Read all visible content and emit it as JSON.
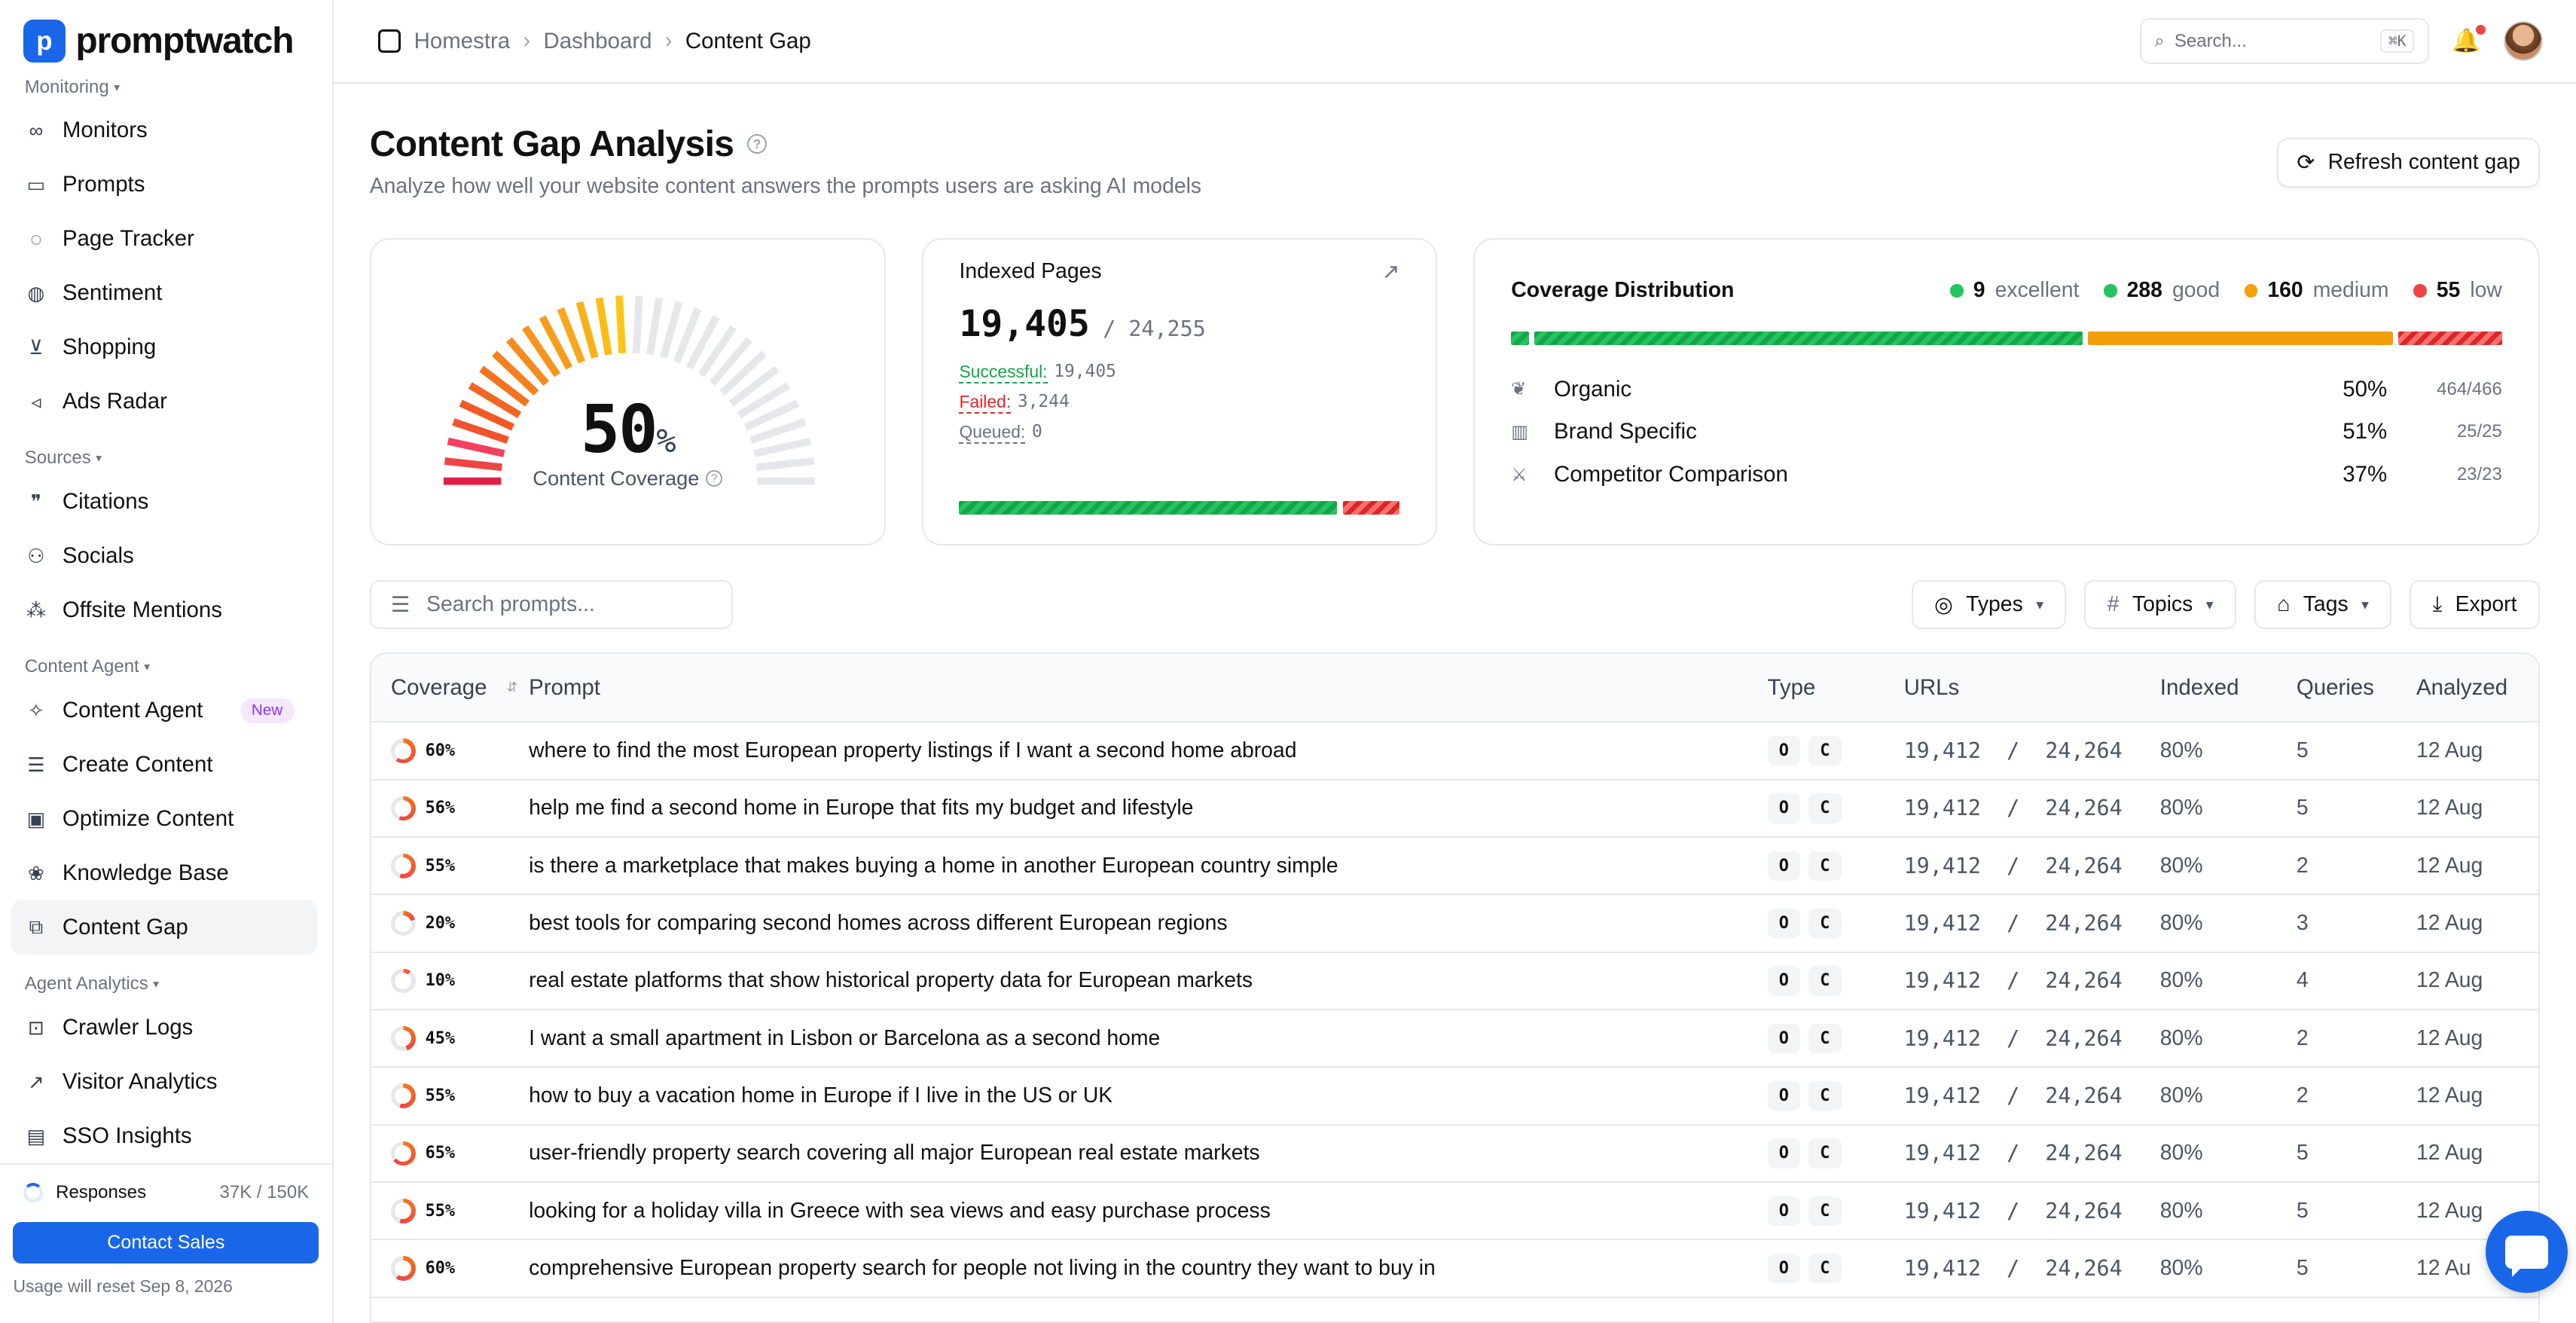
{
  "app": {
    "name": "promptwatch",
    "logo_letter": "p"
  },
  "sidebar": {
    "sections": [
      {
        "label": "Monitoring",
        "items": [
          {
            "label": "Monitors",
            "icon": "binoculars-icon"
          },
          {
            "label": "Prompts",
            "icon": "prompt-icon"
          },
          {
            "label": "Page Tracker",
            "icon": "target-icon"
          },
          {
            "label": "Sentiment",
            "icon": "shield-icon"
          },
          {
            "label": "Shopping",
            "icon": "cart-icon"
          },
          {
            "label": "Ads Radar",
            "icon": "megaphone-icon"
          }
        ]
      },
      {
        "label": "Sources",
        "items": [
          {
            "label": "Citations",
            "icon": "quote-icon"
          },
          {
            "label": "Socials",
            "icon": "users-icon"
          },
          {
            "label": "Offsite Mentions",
            "icon": "share-icon"
          }
        ]
      },
      {
        "label": "Content Agent",
        "items": [
          {
            "label": "Content Agent",
            "icon": "sparkles-icon",
            "badge": "New"
          },
          {
            "label": "Create Content",
            "icon": "document-icon"
          },
          {
            "label": "Optimize Content",
            "icon": "image-icon"
          },
          {
            "label": "Knowledge Base",
            "icon": "brain-icon"
          },
          {
            "label": "Content Gap",
            "icon": "puzzle-icon",
            "active": true
          }
        ]
      },
      {
        "label": "Agent Analytics",
        "items": [
          {
            "label": "Crawler Logs",
            "icon": "robot-icon"
          },
          {
            "label": "Visitor Analytics",
            "icon": "chart-line-icon"
          },
          {
            "label": "SSO Insights",
            "icon": "chart-icon"
          }
        ]
      }
    ],
    "responses_label": "Responses",
    "responses_value": "37K / 150K",
    "contact_label": "Contact Sales",
    "reset_text": "Usage will reset Sep 8, 2026"
  },
  "topbar": {
    "breadcrumb": [
      "Homestra",
      "Dashboard",
      "Content Gap"
    ],
    "search_placeholder": "Search...",
    "search_shortcut": "⌘K"
  },
  "header": {
    "title": "Content Gap Analysis",
    "subtitle": "Analyze how well your website content answers the prompts users are asking AI models",
    "refresh_label": "Refresh content gap"
  },
  "gauge": {
    "value": "50",
    "unit": "%",
    "label": "Content Coverage",
    "fraction": 0.5
  },
  "indexed": {
    "title": "Indexed Pages",
    "indexed": "19,405",
    "total": "/ 24,255",
    "successful_label": "Successful:",
    "successful": "19,405",
    "failed_label": "Failed:",
    "failed": "3,244",
    "queued_label": "Queued:",
    "queued": "0",
    "success_ratio": 0.857
  },
  "coverage": {
    "title": "Coverage Distribution",
    "legend": [
      {
        "count": "9",
        "label": "excellent",
        "color": "#22c55e"
      },
      {
        "count": "288",
        "label": "good",
        "color": "#22c55e"
      },
      {
        "count": "160",
        "label": "medium",
        "color": "#f59e0b"
      },
      {
        "count": "55",
        "label": "low",
        "color": "#ef4444"
      }
    ],
    "rows": [
      {
        "label": "Organic",
        "pct": "50%",
        "frac": "464/466",
        "icon": "sprout-icon"
      },
      {
        "label": "Brand Specific",
        "pct": "51%",
        "frac": "25/25",
        "icon": "building-icon"
      },
      {
        "label": "Competitor Comparison",
        "pct": "37%",
        "frac": "23/23",
        "icon": "swords-icon"
      }
    ]
  },
  "filters": {
    "search_placeholder": "Search prompts...",
    "types": "Types",
    "topics": "Topics",
    "tags": "Tags",
    "export": "Export"
  },
  "table": {
    "headers": {
      "coverage": "Coverage",
      "prompt": "Prompt",
      "type": "Type",
      "urls": "URLs",
      "indexed": "Indexed",
      "queries": "Queries",
      "analyzed": "Analyzed"
    },
    "rows": [
      {
        "coverage": "60%",
        "cov": 60,
        "prompt": "where to find the most European property listings if I want a second home abroad",
        "t1": "O",
        "t2": "C",
        "urls": "19,412  /  24,264",
        "indexed": "80%",
        "queries": "5",
        "analyzed": "12 Aug"
      },
      {
        "coverage": "56%",
        "cov": 56,
        "prompt": "help me find a second home in Europe that fits my budget and lifestyle",
        "t1": "O",
        "t2": "C",
        "urls": "19,412  /  24,264",
        "indexed": "80%",
        "queries": "5",
        "analyzed": "12 Aug"
      },
      {
        "coverage": "55%",
        "cov": 55,
        "prompt": "is there a marketplace that makes buying a home in another European country simple",
        "t1": "O",
        "t2": "C",
        "urls": "19,412  /  24,264",
        "indexed": "80%",
        "queries": "2",
        "analyzed": "12 Aug"
      },
      {
        "coverage": "20%",
        "cov": 20,
        "prompt": "best tools for comparing second homes across different European regions",
        "t1": "O",
        "t2": "C",
        "urls": "19,412  /  24,264",
        "indexed": "80%",
        "queries": "3",
        "analyzed": "12 Aug"
      },
      {
        "coverage": "10%",
        "cov": 10,
        "prompt": "real estate platforms that show historical property data for European markets",
        "t1": "O",
        "t2": "C",
        "urls": "19,412  /  24,264",
        "indexed": "80%",
        "queries": "4",
        "analyzed": "12 Aug"
      },
      {
        "coverage": "45%",
        "cov": 45,
        "prompt": "I want a small apartment in Lisbon or Barcelona as a second home",
        "t1": "O",
        "t2": "C",
        "urls": "19,412  /  24,264",
        "indexed": "80%",
        "queries": "2",
        "analyzed": "12 Aug"
      },
      {
        "coverage": "55%",
        "cov": 55,
        "prompt": "how to buy a vacation home in Europe if I live in the US or UK",
        "t1": "O",
        "t2": "C",
        "urls": "19,412  /  24,264",
        "indexed": "80%",
        "queries": "2",
        "analyzed": "12 Aug"
      },
      {
        "coverage": "65%",
        "cov": 65,
        "prompt": "user-friendly property search covering all major European real estate markets",
        "t1": "O",
        "t2": "C",
        "urls": "19,412  /  24,264",
        "indexed": "80%",
        "queries": "5",
        "analyzed": "12 Aug"
      },
      {
        "coverage": "55%",
        "cov": 55,
        "prompt": "looking for a holiday villa in Greece with sea views and easy purchase process",
        "t1": "O",
        "t2": "C",
        "urls": "19,412  /  24,264",
        "indexed": "80%",
        "queries": "5",
        "analyzed": "12 Aug"
      },
      {
        "coverage": "60%",
        "cov": 60,
        "prompt": "comprehensive European property search for people not living in the country they want to buy in",
        "t1": "O",
        "t2": "C",
        "urls": "19,412  /  24,264",
        "indexed": "80%",
        "queries": "5",
        "analyzed": "12 Au"
      }
    ]
  }
}
